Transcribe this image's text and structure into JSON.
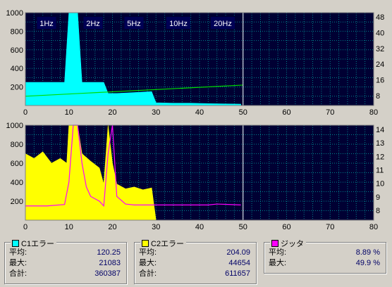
{
  "colors": {
    "background": "#d4d0c8",
    "plot_bg": "#000033",
    "grid": "#00a0a0",
    "c1": "#00ffff",
    "c2": "#ffff00",
    "jitter": "#ff00ff",
    "speed": "#00dd00",
    "label_box": "#000055"
  },
  "top_chart": {
    "speed_labels": [
      "1Hz",
      "2Hz",
      "5Hz",
      "10Hz",
      "20Hz"
    ],
    "y_ticks_left": [
      "1000",
      "800",
      "600",
      "400",
      "200"
    ],
    "y_ticks_right": [
      "48",
      "40",
      "32",
      "24",
      "16",
      "8"
    ],
    "x_ticks": [
      "0",
      "10",
      "20",
      "30",
      "40",
      "50",
      "60",
      "70",
      "80"
    ]
  },
  "bottom_chart": {
    "y_ticks_left": [
      "1000",
      "800",
      "600",
      "400",
      "200"
    ],
    "y_ticks_right": [
      "14",
      "13",
      "12",
      "11",
      "10",
      "9",
      "8"
    ],
    "x_ticks": [
      "0",
      "10",
      "20",
      "30",
      "40",
      "50",
      "60",
      "70",
      "80"
    ]
  },
  "chart_data": [
    {
      "type": "bar",
      "series": [
        {
          "name": "C1エラー",
          "points": [
            [
              0,
              250
            ],
            [
              1,
              250
            ],
            [
              5,
              250
            ],
            [
              9,
              250
            ],
            [
              10,
              1000
            ],
            [
              11,
              1000
            ],
            [
              12,
              1000
            ],
            [
              13,
              250
            ],
            [
              17,
              250
            ],
            [
              18,
              250
            ],
            [
              19,
              130
            ],
            [
              21,
              130
            ],
            [
              25,
              140
            ],
            [
              29,
              150
            ],
            [
              30,
              30
            ],
            [
              34,
              25
            ],
            [
              38,
              25
            ],
            [
              42,
              20
            ],
            [
              46,
              18
            ],
            [
              49.5,
              15
            ]
          ]
        },
        {
          "name": "speed",
          "points": [
            [
              0,
              100
            ],
            [
              50,
              220
            ]
          ]
        }
      ],
      "xlim": [
        0,
        80
      ],
      "ylim": [
        0,
        1000
      ],
      "y2lim": [
        0,
        52
      ],
      "end_marker_x": 50
    },
    {
      "type": "bar",
      "series": [
        {
          "name": "C2エラー",
          "points": [
            [
              0,
              700
            ],
            [
              2,
              650
            ],
            [
              4,
              720
            ],
            [
              6,
              600
            ],
            [
              8,
              650
            ],
            [
              9.5,
              600
            ],
            [
              10,
              1000
            ],
            [
              12,
              1000
            ],
            [
              13,
              700
            ],
            [
              15,
              620
            ],
            [
              17,
              550
            ],
            [
              18,
              380
            ],
            [
              19,
              1000
            ],
            [
              20,
              600
            ],
            [
              21,
              380
            ],
            [
              23,
              330
            ],
            [
              25,
              350
            ],
            [
              27,
              320
            ],
            [
              29,
              340
            ],
            [
              30,
              0
            ]
          ]
        },
        {
          "name": "ジッタ",
          "points": [
            [
              0,
              150
            ],
            [
              5,
              150
            ],
            [
              9,
              165
            ],
            [
              10,
              400
            ],
            [
              11,
              1000
            ],
            [
              12,
              1000
            ],
            [
              13,
              600
            ],
            [
              14,
              350
            ],
            [
              15,
              250
            ],
            [
              17,
              200
            ],
            [
              18,
              150
            ],
            [
              19,
              700
            ],
            [
              20,
              1000
            ],
            [
              21,
              250
            ],
            [
              23,
              170
            ],
            [
              25,
              160
            ],
            [
              29,
              160
            ],
            [
              31,
              160
            ],
            [
              38,
              160
            ],
            [
              42,
              160
            ],
            [
              44,
              170
            ],
            [
              47,
              165
            ],
            [
              49.5,
              160
            ]
          ]
        }
      ],
      "xlim": [
        0,
        80
      ],
      "ylim": [
        0,
        1000
      ],
      "y2lim": [
        7,
        15
      ],
      "end_marker_x": 50
    }
  ],
  "stats": {
    "c1": {
      "title": "C1エラー",
      "avg_label": "平均:",
      "avg": "120.25",
      "max_label": "最大:",
      "max": "21083",
      "total_label": "合計:",
      "total": "360387"
    },
    "c2": {
      "title": "C2エラー",
      "avg_label": "平均:",
      "avg": "204.09",
      "max_label": "最大:",
      "max": "44654",
      "total_label": "合計:",
      "total": "611657"
    },
    "jitter": {
      "title": "ジッタ",
      "avg_label": "平均:",
      "avg": "8.89 %",
      "max_label": "最大:",
      "max": "49.9 %"
    }
  }
}
